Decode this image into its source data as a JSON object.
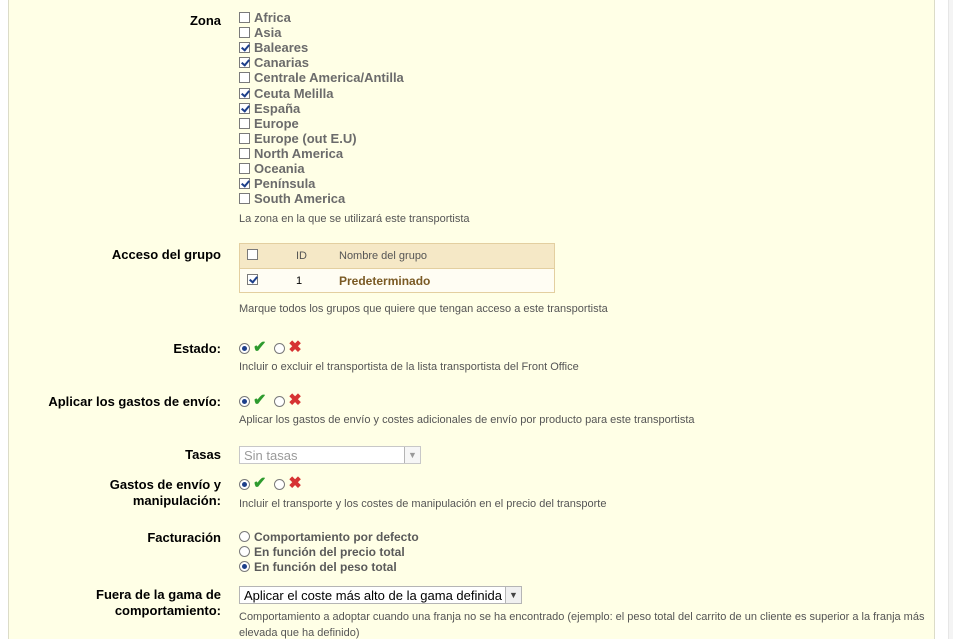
{
  "zona": {
    "label": "Zona",
    "hint": "La zona en la que se utilizará este transportista",
    "items": [
      {
        "name": "Africa",
        "checked": false
      },
      {
        "name": "Asia",
        "checked": false
      },
      {
        "name": "Baleares",
        "checked": true
      },
      {
        "name": "Canarias",
        "checked": true
      },
      {
        "name": "Centrale America/Antilla",
        "checked": false
      },
      {
        "name": "Ceuta Melilla",
        "checked": true
      },
      {
        "name": "España",
        "checked": true
      },
      {
        "name": "Europe",
        "checked": false
      },
      {
        "name": "Europe (out E.U)",
        "checked": false
      },
      {
        "name": "North America",
        "checked": false
      },
      {
        "name": "Oceania",
        "checked": false
      },
      {
        "name": "Península",
        "checked": true
      },
      {
        "name": "South America",
        "checked": false
      }
    ]
  },
  "acceso": {
    "label": "Acceso del grupo",
    "col_id": "ID",
    "col_name": "Nombre del grupo",
    "rows": [
      {
        "id": "1",
        "name": "Predeterminado",
        "checked": true
      }
    ],
    "hint": "Marque todos los grupos que quiere que tengan acceso a este transportista"
  },
  "estado": {
    "label": "Estado:",
    "hint": "Incluir o excluir el transportista de la lista transportista del Front Office",
    "yes_icon": "check-icon",
    "no_icon": "cross-icon"
  },
  "gastos_envio": {
    "label": "Aplicar los gastos de envío:",
    "hint": "Aplicar los gastos de envío y costes adicionales de envío por producto para este transportista"
  },
  "tasas": {
    "label": "Tasas",
    "value": "Sin tasas"
  },
  "manipulacion": {
    "label_line1": "Gastos de envío y",
    "label_line2": "manipulación:",
    "hint": "Incluir el transporte y los costes de manipulación en el precio del transporte"
  },
  "facturacion": {
    "label": "Facturación",
    "options": [
      {
        "label": "Comportamiento por defecto",
        "selected": false
      },
      {
        "label": "En función del precio total",
        "selected": false
      },
      {
        "label": "En función del peso total",
        "selected": true
      }
    ]
  },
  "fuera_gama": {
    "label_line1": "Fuera de la gama de",
    "label_line2": "comportamiento:",
    "value": "Aplicar el coste más alto de la gama definida",
    "hint_line1": "Comportamiento a adoptar cuando una franja no se ha encontrado (ejemplo: el peso total del carrito de un cliente es superior a la franja más",
    "hint_line2": "elevada que ha definido)"
  },
  "colors": {
    "panel_bg": "#ffffe6",
    "table_head": "#f5e8c6",
    "check_green": "#2e9b2e",
    "cross_red": "#d63333"
  }
}
